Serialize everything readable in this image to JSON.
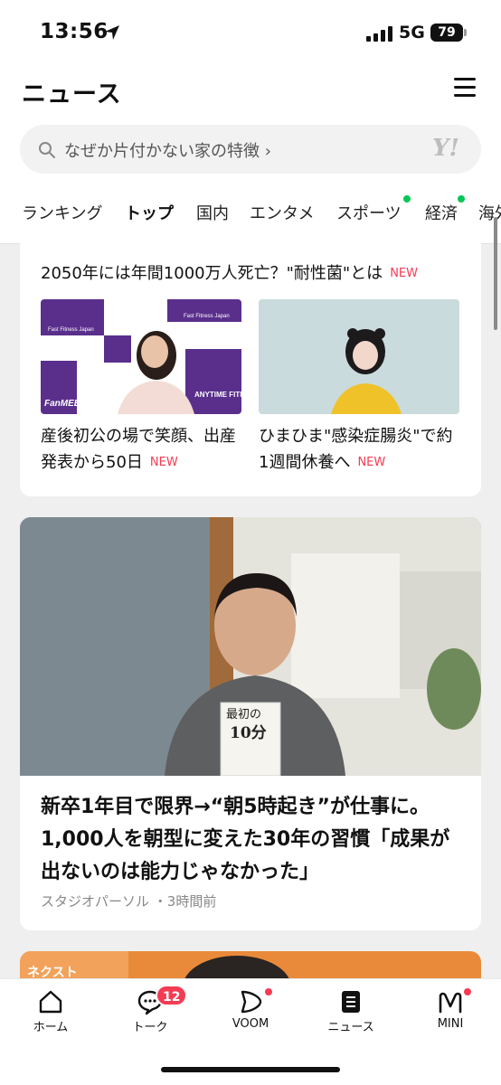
{
  "status_bar": {
    "time": "13:56",
    "network": "5G",
    "battery": "79"
  },
  "header": {
    "title": "ニュース",
    "search_text": "なぜか片付かない家の特徴 ›",
    "yahoo_logo": "Y!"
  },
  "tabs": [
    {
      "label": "ランキング",
      "active": false,
      "dot": false
    },
    {
      "label": "トップ",
      "active": true,
      "dot": false
    },
    {
      "label": "国内",
      "active": false,
      "dot": false
    },
    {
      "label": "エンタメ",
      "active": false,
      "dot": false
    },
    {
      "label": "スポーツ",
      "active": false,
      "dot": true
    },
    {
      "label": "経済",
      "active": false,
      "dot": true
    },
    {
      "label": "海外",
      "active": false,
      "dot": false
    }
  ],
  "card1": {
    "headline": "2050年には年間1000万人死亡？\"耐性菌\"とは",
    "new_label": "NEW",
    "articles": [
      {
        "caption": "産後初公の場で笑顔、出産発表から50日",
        "new_label": "NEW",
        "image_text": [
          "Fast Fitness Japan",
          "Fast Fitness Japan",
          "FanMEET",
          "ANYTIME FITNESS"
        ]
      },
      {
        "caption": "ひまひま\"感染症腸炎\"で約1週間休養へ",
        "new_label": "NEW"
      }
    ]
  },
  "card2": {
    "title": "新卒1年目で限界→“朝5時起き”が仕事に。1,000人を朝型に変えた30年の習慣「成果が出ないのは能力じゃなかった」",
    "source": "スタジオパーソル",
    "time_ago": "3時間前",
    "book_text": [
      "最初の",
      "10分"
    ],
    "card3_image_text": "ネクスト"
  },
  "bottom_nav": [
    {
      "label": "ホーム",
      "icon": "home-icon"
    },
    {
      "label": "トーク",
      "icon": "chat-icon",
      "badge": "12"
    },
    {
      "label": "VOOM",
      "icon": "voom-icon",
      "dot": true
    },
    {
      "label": "ニュース",
      "icon": "news-icon",
      "active": true
    },
    {
      "label": "MINI",
      "icon": "mini-icon",
      "dot": true
    }
  ],
  "colors": {
    "accent_green": "#06c755",
    "badge_red": "#f33c54",
    "new_red": "#f33c54"
  }
}
